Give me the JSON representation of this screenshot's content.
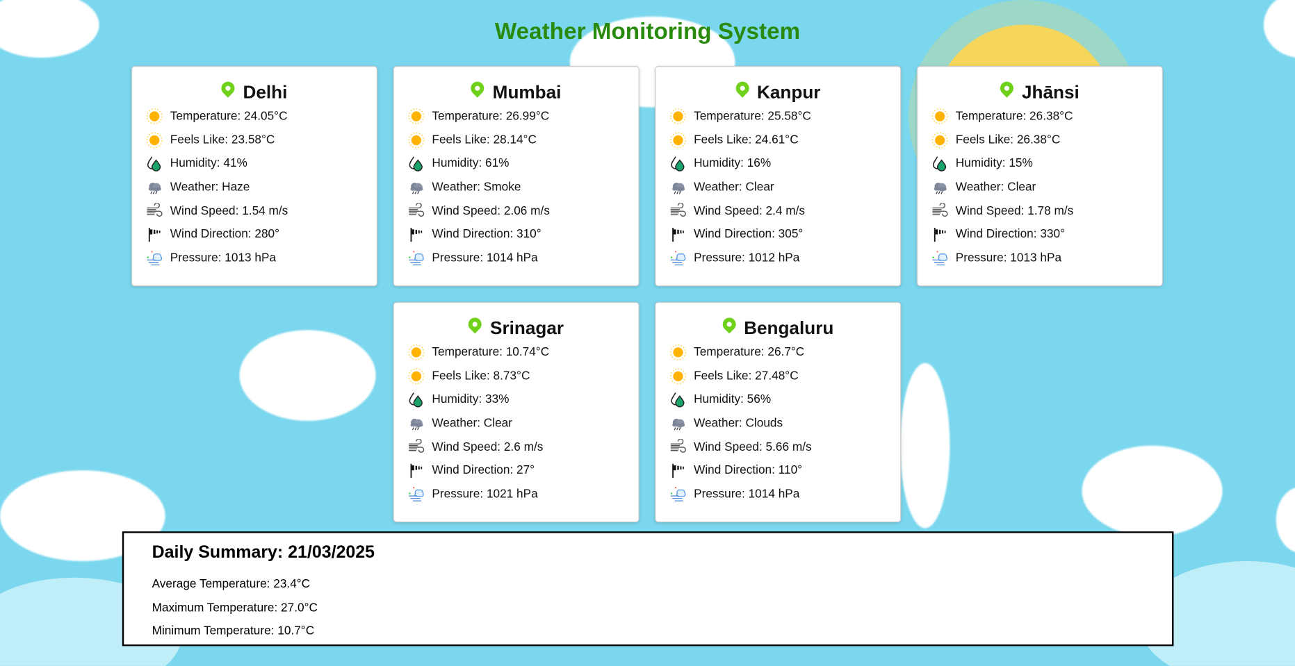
{
  "title": "Weather Monitoring System",
  "colors": {
    "title": "#2a8a0e",
    "pin": "#6fd11a",
    "sky": "#7bd7ee"
  },
  "icons": {
    "temperature": "sun-icon",
    "feels_like": "sun-icon",
    "humidity": "humidity-drop-icon",
    "weather": "storm-cloud-icon",
    "wind_speed": "wind-icon",
    "wind_direction": "windsock-icon",
    "pressure": "pressure-icon",
    "city": "location-pin-icon"
  },
  "cities": [
    {
      "name": "Delhi",
      "temperature": "Temperature: 24.05°C",
      "feels_like": "Feels Like: 23.58°C",
      "humidity": "Humidity: 41%",
      "weather": "Weather: Haze",
      "wind_speed": "Wind Speed: 1.54 m/s",
      "wind_direction": "Wind Direction: 280°",
      "pressure": "Pressure: 1013 hPa"
    },
    {
      "name": "Mumbai",
      "temperature": "Temperature: 26.99°C",
      "feels_like": "Feels Like: 28.14°C",
      "humidity": "Humidity: 61%",
      "weather": "Weather: Smoke",
      "wind_speed": "Wind Speed: 2.06 m/s",
      "wind_direction": "Wind Direction: 310°",
      "pressure": "Pressure: 1014 hPa"
    },
    {
      "name": "Kanpur",
      "temperature": "Temperature: 25.58°C",
      "feels_like": "Feels Like: 24.61°C",
      "humidity": "Humidity: 16%",
      "weather": "Weather: Clear",
      "wind_speed": "Wind Speed: 2.4 m/s",
      "wind_direction": "Wind Direction: 305°",
      "pressure": "Pressure: 1012 hPa"
    },
    {
      "name": "Jhānsi",
      "temperature": "Temperature: 26.38°C",
      "feels_like": "Feels Like: 26.38°C",
      "humidity": "Humidity: 15%",
      "weather": "Weather: Clear",
      "wind_speed": "Wind Speed: 1.78 m/s",
      "wind_direction": "Wind Direction: 330°",
      "pressure": "Pressure: 1013 hPa"
    },
    {
      "name": "Srinagar",
      "temperature": "Temperature: 10.74°C",
      "feels_like": "Feels Like: 8.73°C",
      "humidity": "Humidity: 33%",
      "weather": "Weather: Clear",
      "wind_speed": "Wind Speed: 2.6 m/s",
      "wind_direction": "Wind Direction: 27°",
      "pressure": "Pressure: 1021 hPa"
    },
    {
      "name": "Bengaluru",
      "temperature": "Temperature: 26.7°C",
      "feels_like": "Feels Like: 27.48°C",
      "humidity": "Humidity: 56%",
      "weather": "Weather: Clouds",
      "wind_speed": "Wind Speed: 5.66 m/s",
      "wind_direction": "Wind Direction: 110°",
      "pressure": "Pressure: 1014 hPa"
    }
  ],
  "summary": {
    "title": "Daily Summary: 21/03/2025",
    "average": "Average Temperature: 23.4°C",
    "maximum": "Maximum Temperature: 27.0°C",
    "minimum": "Minimum Temperature: 10.7°C"
  }
}
